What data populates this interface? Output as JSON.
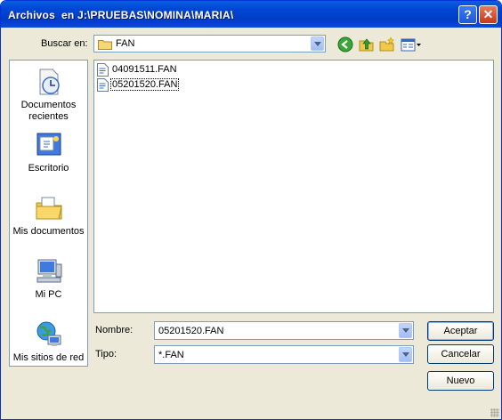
{
  "window": {
    "title": "Archivos  en J:\\PRUEBAS\\NOMINA\\MARIA\\",
    "help_label": "?",
    "close_label": "✕"
  },
  "toolbar": {
    "lookin_label": "Buscar en:",
    "lookin_value": "FAN",
    "icons": [
      "back-icon",
      "up-folder-icon",
      "new-folder-icon",
      "view-menu-icon"
    ]
  },
  "places": [
    {
      "label": "Documentos recientes",
      "icon": "recent-documents-icon"
    },
    {
      "label": "Escritorio",
      "icon": "desktop-icon"
    },
    {
      "label": "Mis documentos",
      "icon": "my-documents-icon"
    },
    {
      "label": "Mi PC",
      "icon": "my-computer-icon"
    },
    {
      "label": "Mis sitios de red",
      "icon": "network-places-icon"
    }
  ],
  "files": [
    {
      "name": "04091511.FAN",
      "selected": false
    },
    {
      "name": "05201520.FAN",
      "selected": true
    }
  ],
  "form": {
    "name_label": "Nombre:",
    "name_value": "05201520.FAN",
    "type_label": "Tipo:",
    "type_value": "*.FAN"
  },
  "buttons": {
    "accept": "Aceptar",
    "cancel": "Cancelar",
    "new": "Nuevo"
  }
}
